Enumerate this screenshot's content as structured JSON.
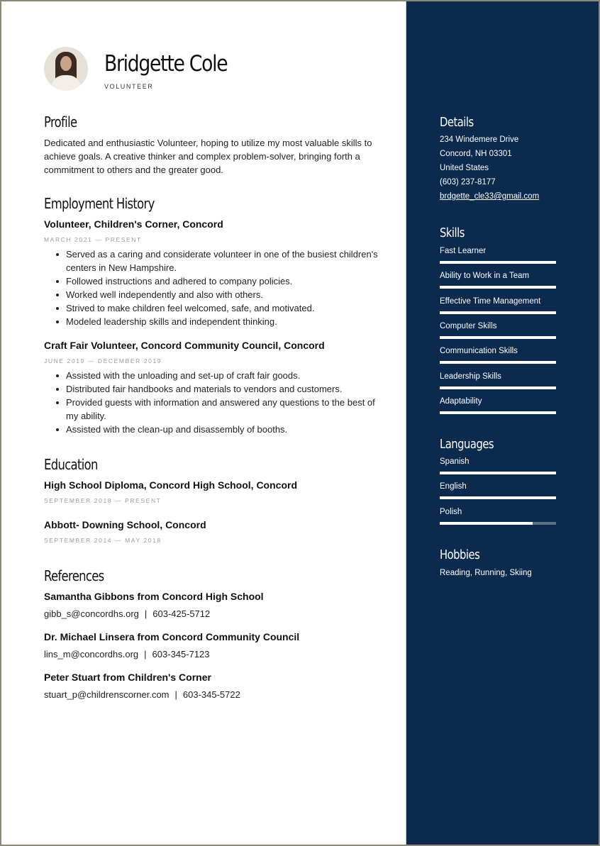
{
  "header": {
    "name": "Bridgette Cole",
    "job_title": "VOLUNTEER",
    "avatar": "profile-photo"
  },
  "profile": {
    "title": "Profile",
    "text": "Dedicated and enthusiastic Volunteer, hoping to utilize my most valuable skills to achieve goals. A creative thinker and complex problem-solver, bringing forth a commitment to others and the greater good."
  },
  "employment": {
    "title": "Employment History",
    "jobs": [
      {
        "title": "Volunteer, Children's Corner, Concord",
        "dates": "MARCH 2021 — PRESENT",
        "bullets": [
          "Served as a caring and considerate volunteer in one of the busiest children's centers in New Hampshire.",
          "Followed instructions and adhered to company policies.",
          "Worked well independently and also with others.",
          "Strived to make children feel welcomed, safe, and motivated.",
          "Modeled leadership skills and independent thinking."
        ]
      },
      {
        "title": "Craft Fair Volunteer, Concord Community Council, Concord",
        "dates": "JUNE 2019 — DECEMBER 2019",
        "bullets": [
          "Assisted with the unloading and set-up of craft fair goods.",
          "Distributed fair handbooks and materials to vendors and customers.",
          "Provided guests with information and answered any questions to the best of my ability.",
          "Assisted with the clean-up and disassembly of booths."
        ]
      }
    ]
  },
  "education": {
    "title": "Education",
    "items": [
      {
        "title": "High School Diploma, Concord High School, Concord",
        "dates": "SEPTEMBER 2018 — PRESENT"
      },
      {
        "title": "Abbott- Downing School, Concord",
        "dates": "SEPTEMBER 2014 — MAY 2018"
      }
    ]
  },
  "references": {
    "title": "References",
    "items": [
      {
        "name": "Samantha Gibbons from Concord High School",
        "email": "gibb_s@concordhs.org",
        "separator": "|",
        "phone": "603-425-5712"
      },
      {
        "name": "Dr. Michael Linsera from Concord Community Council",
        "email": "lins_m@concordhs.org",
        "separator": "|",
        "phone": "603-345-7123"
      },
      {
        "name": "Peter Stuart from Children's Corner",
        "email": "stuart_p@childrenscorner.com",
        "separator": "|",
        "phone": "603-345-5722"
      }
    ]
  },
  "sidebar": {
    "background_color": "#0b2a4e",
    "details": {
      "title": "Details",
      "address_line1": "234 Windemere Drive",
      "address_line2": "Concord, NH 03301",
      "country": "United States",
      "phone": "(603) 237-8177",
      "email": "brdgette_cle33@gmail.com"
    },
    "skills": {
      "title": "Skills",
      "items": [
        {
          "label": "Fast Learner",
          "level": 1.0
        },
        {
          "label": "Ability to Work in a Team",
          "level": 1.0
        },
        {
          "label": "Effective Time Management",
          "level": 1.0
        },
        {
          "label": "Computer Skills",
          "level": 1.0
        },
        {
          "label": "Communication Skills",
          "level": 1.0
        },
        {
          "label": "Leadership Skills",
          "level": 1.0
        },
        {
          "label": "Adaptability",
          "level": 1.0
        }
      ]
    },
    "languages": {
      "title": "Languages",
      "items": [
        {
          "label": "Spanish",
          "level": 1.0
        },
        {
          "label": "English",
          "level": 1.0
        },
        {
          "label": "Polish",
          "level": 0.8
        }
      ]
    },
    "hobbies": {
      "title": "Hobbies",
      "text": "Reading, Running, Skiing"
    }
  }
}
